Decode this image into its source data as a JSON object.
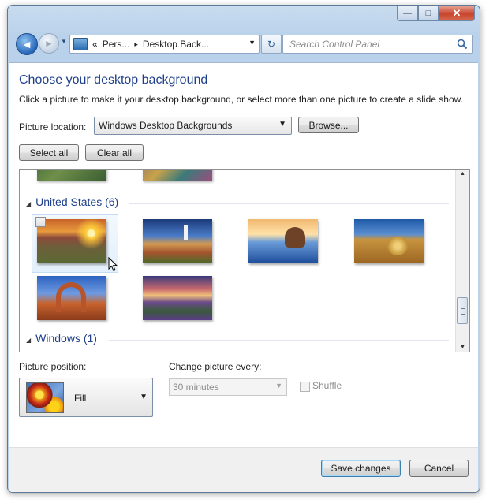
{
  "window": {
    "caption_buttons": {
      "minimize": "—",
      "maximize": "□",
      "close": "✕"
    }
  },
  "nav": {
    "back_glyph": "◄",
    "forward_glyph": "►",
    "address": {
      "chevrons": "«",
      "crumb1": "Pers...",
      "sep": "▸",
      "crumb2": "Desktop Back...",
      "dropdown": "▼",
      "icon": "control-panel-icon"
    },
    "refresh_glyph": "↻",
    "search_placeholder": "Search Control Panel",
    "search_icon": "magnifier-icon"
  },
  "main": {
    "title": "Choose your desktop background",
    "subtitle": "Click a picture to make it your desktop background, or select more than one picture to create a slide show.",
    "location_label": "Picture location:",
    "location_value": "Windows Desktop Backgrounds",
    "browse_label": "Browse...",
    "select_all_label": "Select all",
    "clear_all_label": "Clear all"
  },
  "gallery": {
    "groups": [
      {
        "name": "United States (6)",
        "collapse_glyph": "◢"
      },
      {
        "name": "Windows (1)",
        "collapse_glyph": "◢"
      }
    ],
    "thumbnails": [
      {
        "name": "sunset-meadow",
        "selected": true
      },
      {
        "name": "lighthouse-coast",
        "selected": false
      },
      {
        "name": "sea-stack-rock",
        "selected": false
      },
      {
        "name": "hay-bale-field",
        "selected": false
      },
      {
        "name": "delicate-arch",
        "selected": false
      },
      {
        "name": "lupine-lake",
        "selected": false
      }
    ],
    "scroll": {
      "up": "▲",
      "down": "▼"
    }
  },
  "options": {
    "position_label": "Picture position:",
    "position_value": "Fill",
    "interval_label": "Change picture every:",
    "interval_value": "30 minutes",
    "shuffle_label": "Shuffle",
    "dropdown_glyph": "▼"
  },
  "footer": {
    "save_label": "Save changes",
    "cancel_label": "Cancel"
  },
  "colors": {
    "accent_heading": "#1e3f8a",
    "chrome": "#bcd3eb",
    "close_button": "#c7452c"
  }
}
